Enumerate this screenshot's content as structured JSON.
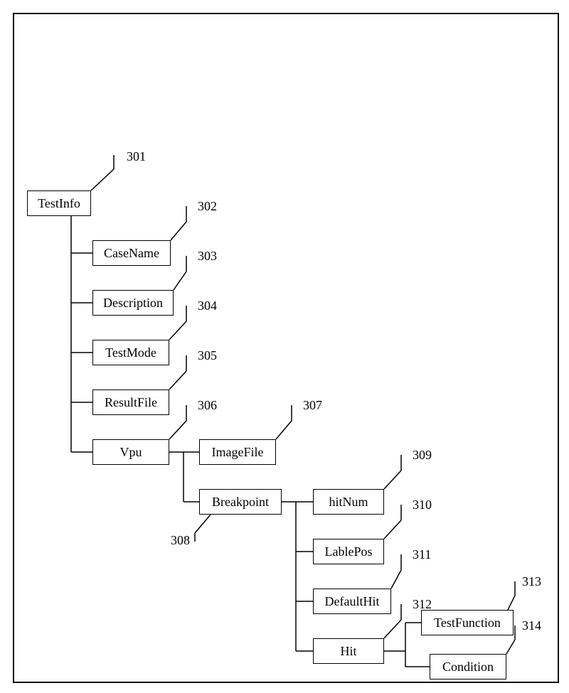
{
  "nodes": {
    "n301": {
      "label": "TestInfo",
      "ref": "301"
    },
    "n302": {
      "label": "CaseName",
      "ref": "302"
    },
    "n303": {
      "label": "Description",
      "ref": "303"
    },
    "n304": {
      "label": "TestMode",
      "ref": "304"
    },
    "n305": {
      "label": "ResultFile",
      "ref": "305"
    },
    "n306": {
      "label": "Vpu",
      "ref": "306"
    },
    "n307": {
      "label": "ImageFile",
      "ref": "307"
    },
    "n308": {
      "label": "Breakpoint",
      "ref": "308"
    },
    "n309": {
      "label": "hitNum",
      "ref": "309"
    },
    "n310": {
      "label": "LablePos",
      "ref": "310"
    },
    "n311": {
      "label": "DefaultHit",
      "ref": "311"
    },
    "n312": {
      "label": "Hit",
      "ref": "312"
    },
    "n313": {
      "label": "TestFunction",
      "ref": "313"
    },
    "n314": {
      "label": "Condition",
      "ref": "314"
    }
  }
}
